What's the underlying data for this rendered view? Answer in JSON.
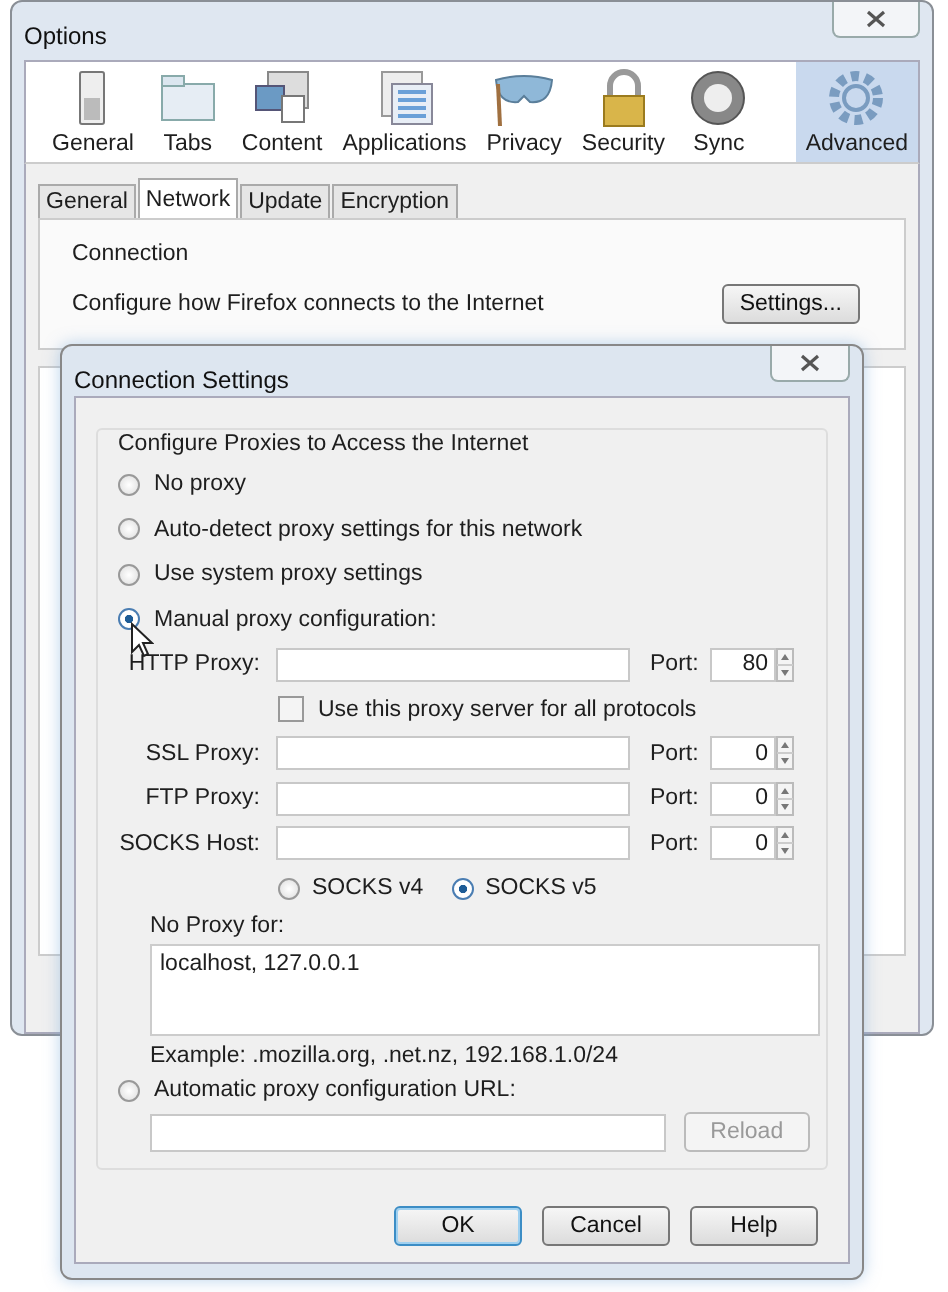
{
  "window": {
    "title": "Options"
  },
  "toolbar": [
    {
      "label": "General",
      "selected": false
    },
    {
      "label": "Tabs",
      "selected": false
    },
    {
      "label": "Content",
      "selected": false
    },
    {
      "label": "Applications",
      "selected": false
    },
    {
      "label": "Privacy",
      "selected": false
    },
    {
      "label": "Security",
      "selected": false
    },
    {
      "label": "Sync",
      "selected": false
    },
    {
      "label": "Advanced",
      "selected": true
    }
  ],
  "subtabs": [
    {
      "label": "General",
      "selected": false
    },
    {
      "label": "Network",
      "selected": true
    },
    {
      "label": "Update",
      "selected": false
    },
    {
      "label": "Encryption",
      "selected": false
    }
  ],
  "connection": {
    "title": "Connection",
    "description": "Configure how Firefox connects to the Internet",
    "button": "Settings..."
  },
  "dialog": {
    "title": "Connection Settings",
    "group_title": "Configure Proxies to Access the Internet",
    "proxy_modes": [
      {
        "label": "No proxy",
        "selected": false
      },
      {
        "label": "Auto-detect proxy settings for this network",
        "selected": false
      },
      {
        "label": "Use system proxy settings",
        "selected": false
      },
      {
        "label": "Manual proxy configuration:",
        "selected": true
      }
    ],
    "proxies": [
      {
        "label": "HTTP Proxy:",
        "port_label": "Port:",
        "port": "80"
      },
      {
        "label": "SSL Proxy:",
        "port_label": "Port:",
        "port": "0"
      },
      {
        "label": "FTP Proxy:",
        "port_label": "Port:",
        "port": "0"
      },
      {
        "label": "SOCKS Host:",
        "port_label": "Port:",
        "port": "0"
      }
    ],
    "share_all": {
      "label": "Use this proxy server for all protocols",
      "checked": false
    },
    "socks_versions": [
      {
        "label": "SOCKS v4",
        "selected": false
      },
      {
        "label": "SOCKS v5",
        "selected": true
      }
    ],
    "no_proxy": {
      "label": "No Proxy for:",
      "value": "localhost, 127.0.0.1"
    },
    "example": "Example: .mozilla.org, .net.nz, 192.168.1.0/24",
    "auto_url": {
      "label": "Automatic proxy configuration URL:",
      "selected": false
    },
    "reload": {
      "label": "Reload",
      "disabled": true
    },
    "buttons": [
      {
        "label": "OK",
        "default": true
      },
      {
        "label": "Cancel",
        "default": false
      },
      {
        "label": "Help",
        "default": false
      }
    ]
  }
}
